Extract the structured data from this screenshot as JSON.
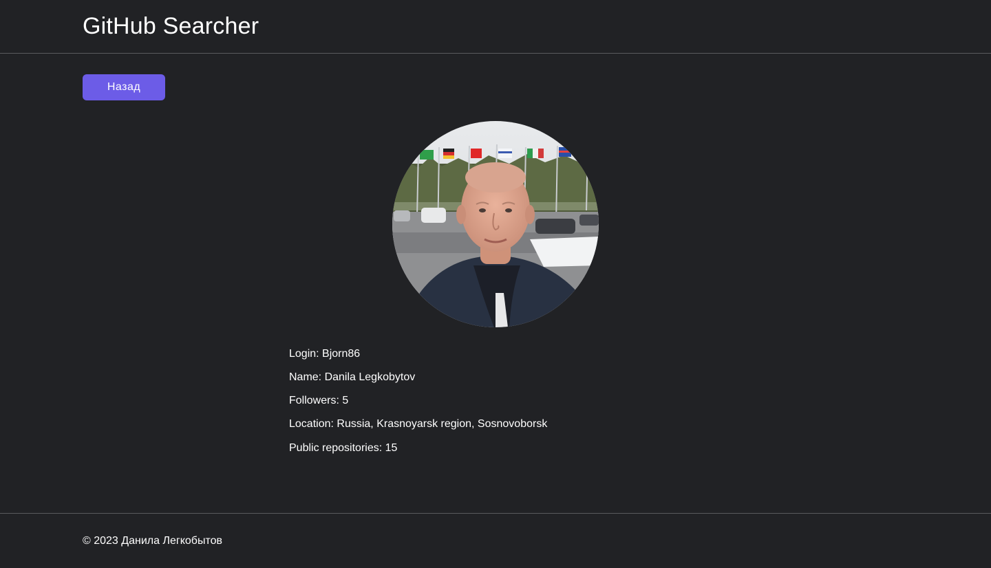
{
  "header": {
    "title": "GitHub Searcher"
  },
  "actions": {
    "back_label": "Назад"
  },
  "profile": {
    "avatar_icon": "user-photo",
    "rows": [
      {
        "label": "Login:",
        "value": "Bjorn86"
      },
      {
        "label": "Name:",
        "value": "Danila Legkobytov"
      },
      {
        "label": "Followers:",
        "value": "5"
      },
      {
        "label": "Location:",
        "value": "Russia, Krasnoyarsk region, Sosnovoborsk"
      },
      {
        "label": "Public repositories:",
        "value": "15"
      }
    ]
  },
  "footer": {
    "copyright": "© 2023 Данила Легкобытов"
  },
  "colors": {
    "background": "#212225",
    "accent": "#6c5ce7",
    "divider": "#5a5b5f",
    "text": "#ffffff"
  }
}
